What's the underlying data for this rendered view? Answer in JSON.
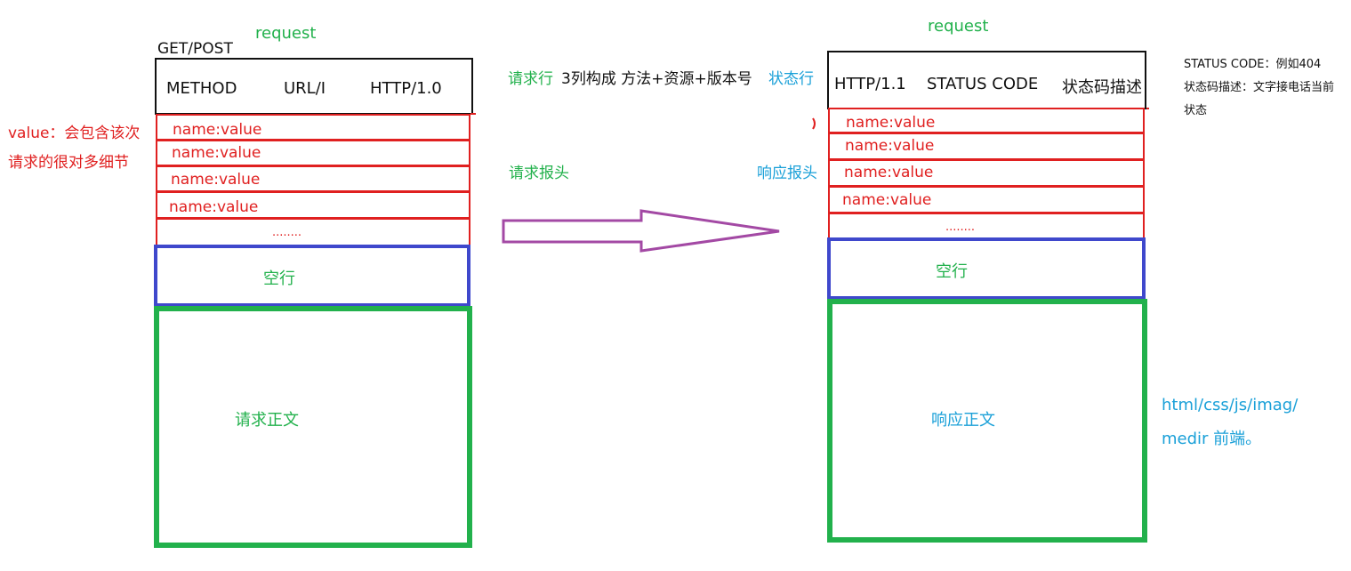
{
  "request": {
    "title": "request",
    "method_label": "GET/POST",
    "request_line": {
      "method": "METHOD",
      "url": "URL/I",
      "version": "HTTP/1.0"
    },
    "headers": [
      "name:value",
      "name:value",
      "name:value",
      "name:value"
    ],
    "ellipsis": "........",
    "blank_line": "空行",
    "body": "请求正文"
  },
  "annotations": {
    "value_note_line1": "value：会包含该次",
    "value_note_line2": "请求的很对多细节",
    "request_line_desc_green": "请求行",
    "request_line_desc_black": "3列构成 方法+资源+版本号",
    "status_line_label": "状态行",
    "request_headers_label": "请求报头",
    "response_headers_label": "响应报头",
    "status_code_note_line1": "STATUS CODE：例如404",
    "status_code_note_line2": "状态码描述：文字接电话当前",
    "status_code_note_line3": "状态",
    "frontend_note_line1": "html/css/js/imag/",
    "frontend_note_line2": "medir 前端。"
  },
  "response": {
    "title": "request",
    "status_line": {
      "version": "HTTP/1.1",
      "code": "STATUS CODE",
      "desc": "状态码描述"
    },
    "headers": [
      "name:value",
      "name:value",
      "name:value",
      "name:value"
    ],
    "ellipsis": "........",
    "blank_line": "空行",
    "body": "响应正文"
  },
  "colors": {
    "black": "#111111",
    "red": "#e02020",
    "blue_border": "#3f48cc",
    "green_border": "#22b14c",
    "green_text": "#22b14c",
    "blue_text": "#1aa0d8",
    "arrow": "#a349a4"
  }
}
